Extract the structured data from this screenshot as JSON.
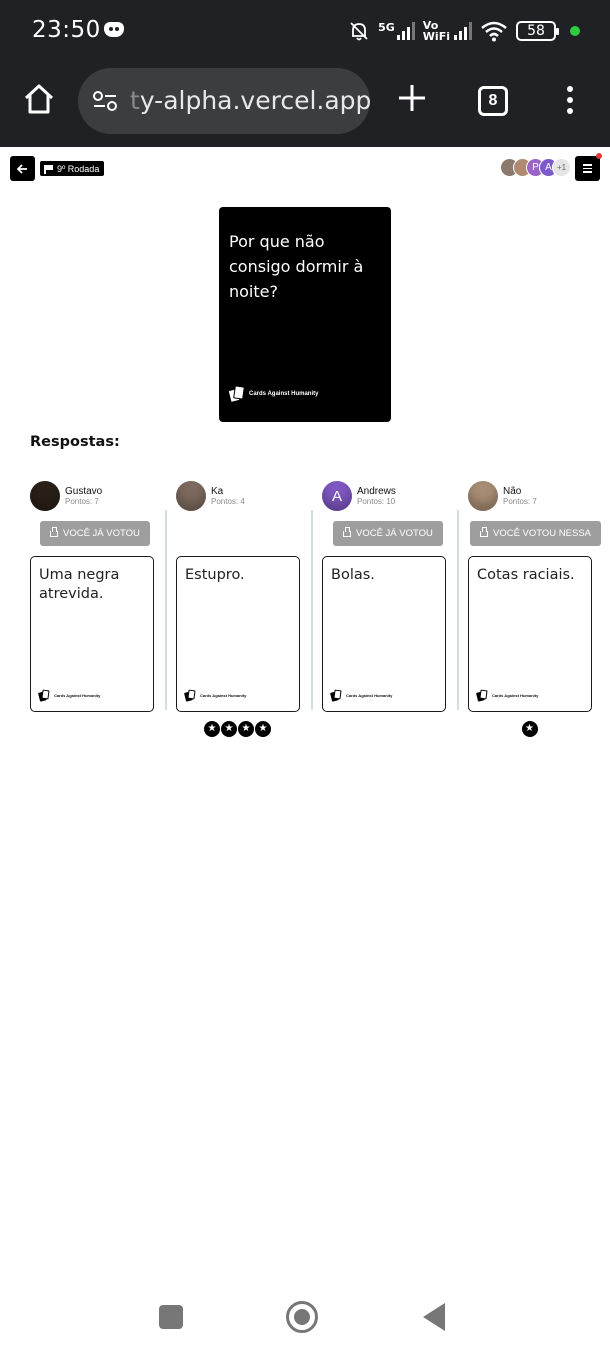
{
  "status_bar": {
    "time": "23:50",
    "network": "5G",
    "wifi_label": "Vo\nWiFi",
    "battery": "58",
    "icons": [
      "discord-icon",
      "bell-muted-icon",
      "signal-icon",
      "wifi-icon",
      "battery-icon"
    ]
  },
  "browser": {
    "url_fade": "t",
    "url": "y-alpha.vercel.app",
    "tab_count": "8"
  },
  "game": {
    "round_label": "9º Rodada",
    "extra_players": "+1",
    "lobby_avatars": [
      {
        "letter": "",
        "color": "#8a7a6e"
      },
      {
        "letter": "",
        "color": "#b08a70"
      },
      {
        "letter": "P",
        "color": "#9b63c7"
      },
      {
        "letter": "A",
        "color": "#7b5bc9"
      }
    ],
    "question": "Por que não consigo dormir à noite?",
    "brand": "Cards Against Humanity",
    "answers_title": "Respostas:",
    "answers": [
      {
        "player": "Gustavo",
        "points": "Pontos: 7",
        "avatar_letter": "",
        "avatar_color": "#2a2018",
        "vote_label": "VOCÊ JÁ VOTOU",
        "show_vote": true,
        "text": "Uma negra atrevida.",
        "stars": ""
      },
      {
        "player": "Ka",
        "points": "Pontos: 4",
        "avatar_letter": "",
        "avatar_color": "#7d6a5e",
        "vote_label": "",
        "show_vote": false,
        "text": "Estupro.",
        "stars": "✪✪✪✪"
      },
      {
        "player": "Andrews",
        "points": "Pontos: 10",
        "avatar_letter": "A",
        "avatar_color": "#7e57c2",
        "vote_label": "VOCÊ JÁ VOTOU",
        "show_vote": true,
        "text": "Bolas.",
        "stars": ""
      },
      {
        "player": "Não",
        "points": "Pontos: 7",
        "avatar_letter": "",
        "avatar_color": "#a88d74",
        "vote_label": "VOCÊ VOTOU NESSA",
        "show_vote": true,
        "text": "Cotas raciais.",
        "stars": "✪"
      }
    ]
  },
  "colors": {
    "chrome_bg": "#202124",
    "url_box": "#3c3d40",
    "vote_button": "#9e9e9e",
    "divider": "#cfdfe3",
    "notification": "#e53935"
  }
}
